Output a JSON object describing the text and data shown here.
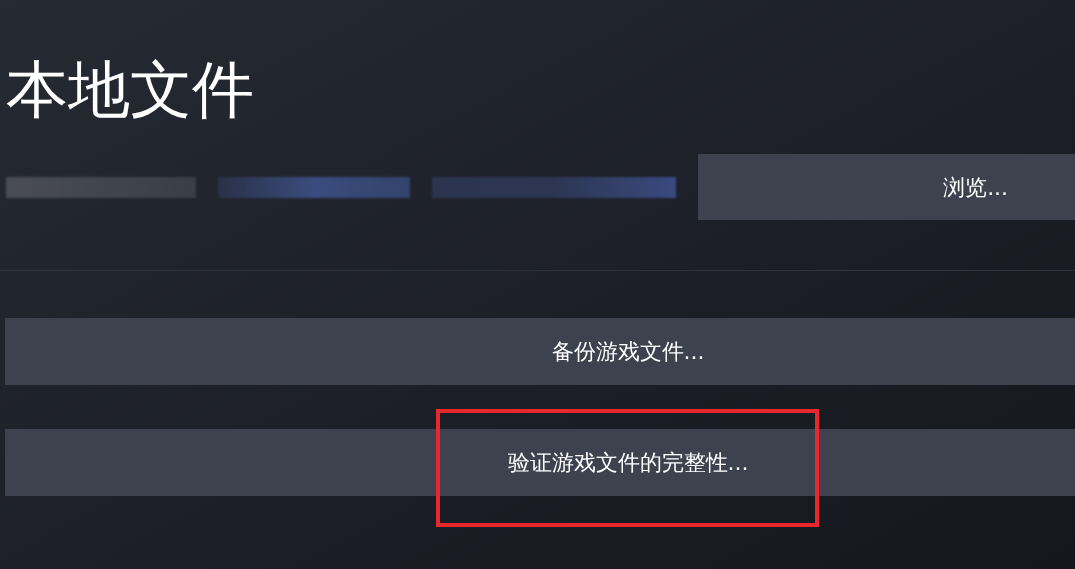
{
  "title": "本地文件",
  "browse_button": "浏览...",
  "actions": [
    {
      "label": "备份游戏文件...",
      "highlighted": false
    },
    {
      "label": "验证游戏文件的完整性...",
      "highlighted": true
    }
  ]
}
